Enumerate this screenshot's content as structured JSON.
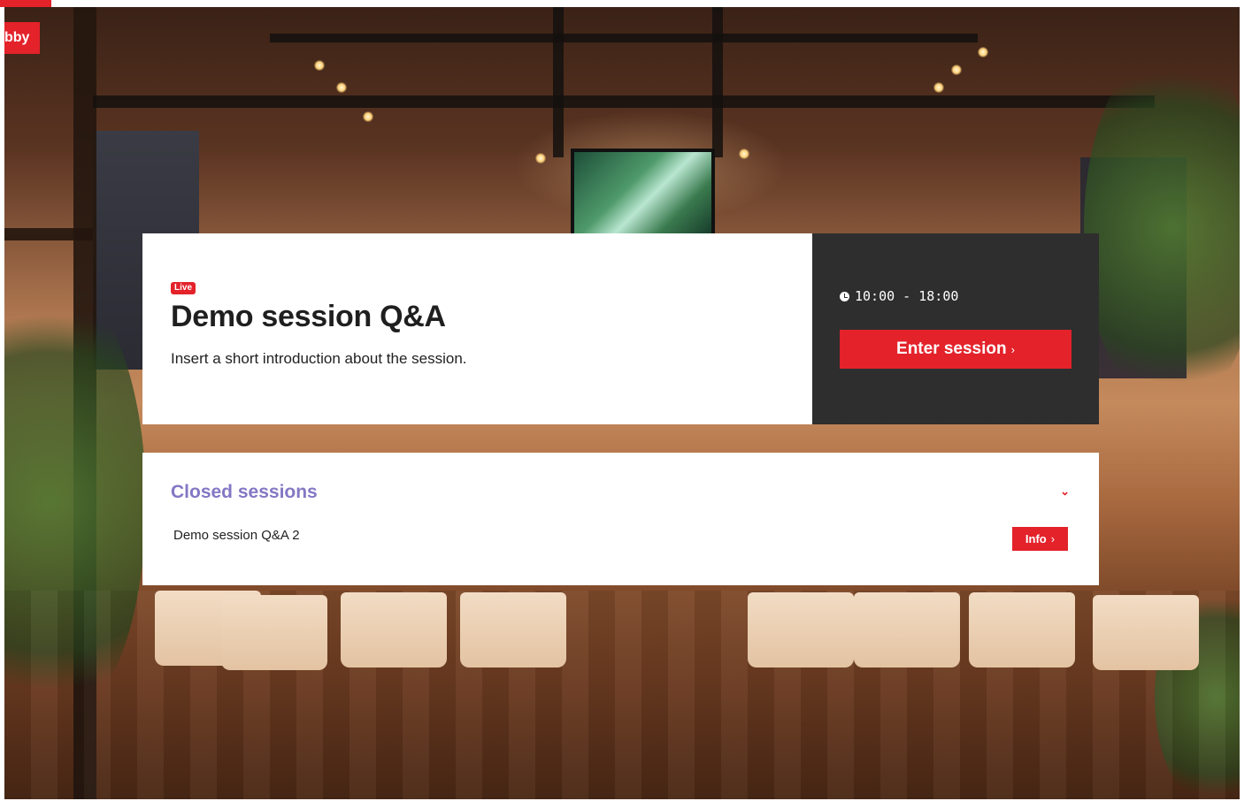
{
  "header": {
    "lobby_label": "bby"
  },
  "background": {
    "description_icon": "event-hall-photo"
  },
  "live_session": {
    "badge": "Live",
    "title": "Demo session Q&A",
    "intro": "Insert a short introduction about the session.",
    "time": "10:00 - 18:00",
    "enter_label": "Enter session",
    "enter_chevron": "›"
  },
  "closed_sessions": {
    "heading": "Closed sessions",
    "toggle_icon": "⌄",
    "items": [
      {
        "name": "Demo session Q&A 2",
        "info_label": "Info",
        "info_chevron": "›"
      }
    ]
  },
  "colors": {
    "accent": "#e3222a",
    "dark_panel": "#2e2e2e",
    "closed_heading": "#8477c4"
  }
}
